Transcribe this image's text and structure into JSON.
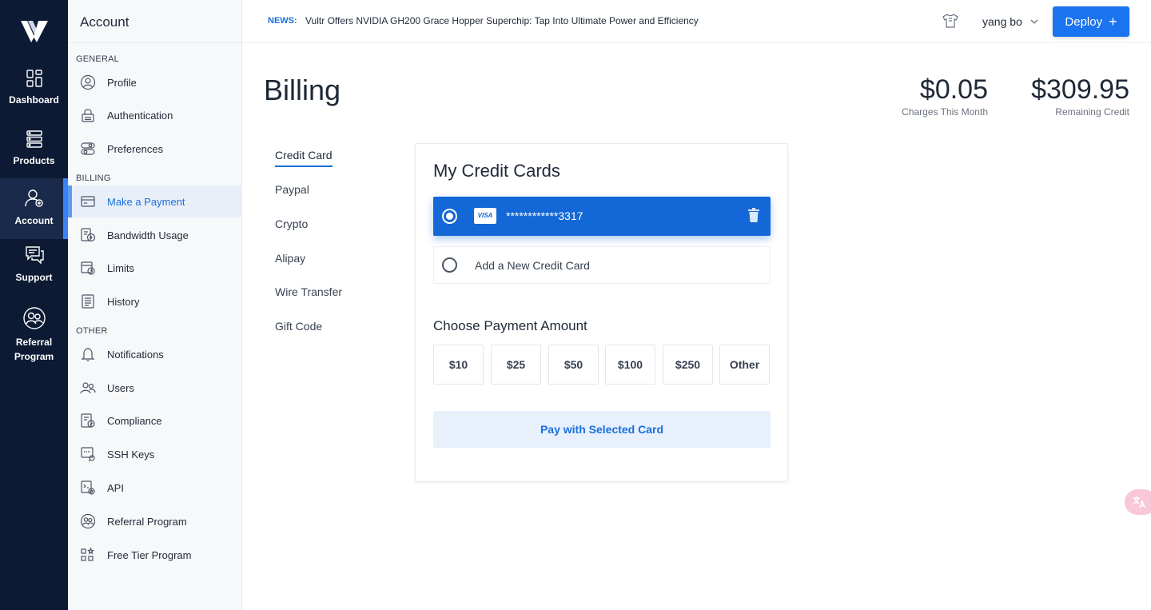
{
  "rail": {
    "items": [
      {
        "label": "Dashboard",
        "icon": "dashboard-icon"
      },
      {
        "label": "Products",
        "icon": "products-icon"
      },
      {
        "label": "Account",
        "icon": "account-icon"
      },
      {
        "label": "Support",
        "icon": "support-icon"
      },
      {
        "label": "Referral Program",
        "icon": "referral-icon"
      }
    ]
  },
  "sidebar": {
    "title": "Account",
    "sections": {
      "general": "GENERAL",
      "billing": "BILLING",
      "other": "OTHER"
    },
    "items": [
      {
        "label": "Profile"
      },
      {
        "label": "Authentication"
      },
      {
        "label": "Preferences"
      },
      {
        "label": "Make a Payment"
      },
      {
        "label": "Bandwidth Usage"
      },
      {
        "label": "Limits"
      },
      {
        "label": "History"
      },
      {
        "label": "Notifications"
      },
      {
        "label": "Users"
      },
      {
        "label": "Compliance"
      },
      {
        "label": "SSH Keys"
      },
      {
        "label": "API"
      },
      {
        "label": "Referral Program"
      },
      {
        "label": "Free Tier Program"
      }
    ]
  },
  "topbar": {
    "news_tag": "NEWS:",
    "news_text": "Vultr Offers NVIDIA GH200 Grace Hopper Superchip: Tap Into Ultimate Power and Efficiency",
    "user_name": "yang bo",
    "deploy_label": "Deploy",
    "deploy_plus": "+"
  },
  "page": {
    "title": "Billing",
    "charges_value": "$0.05",
    "charges_label": "Charges This Month",
    "credit_value": "$309.95",
    "credit_label": "Remaining Credit"
  },
  "tabs": [
    {
      "label": "Credit Card"
    },
    {
      "label": "Paypal"
    },
    {
      "label": "Crypto"
    },
    {
      "label": "Alipay"
    },
    {
      "label": "Wire Transfer"
    },
    {
      "label": "Gift Code"
    }
  ],
  "card": {
    "title": "My Credit Cards",
    "visa_label": "VISA",
    "card_number": "************3317",
    "add_new_label": "Add a New Credit Card",
    "choose_label": "Choose Payment Amount",
    "amounts": [
      "$10",
      "$25",
      "$50",
      "$100",
      "$250",
      "Other"
    ],
    "pay_label": "Pay with Selected Card"
  },
  "colors": {
    "rail_bg": "#0c1a33",
    "accent": "#1a74f0",
    "selected_card": "#1467d6"
  }
}
